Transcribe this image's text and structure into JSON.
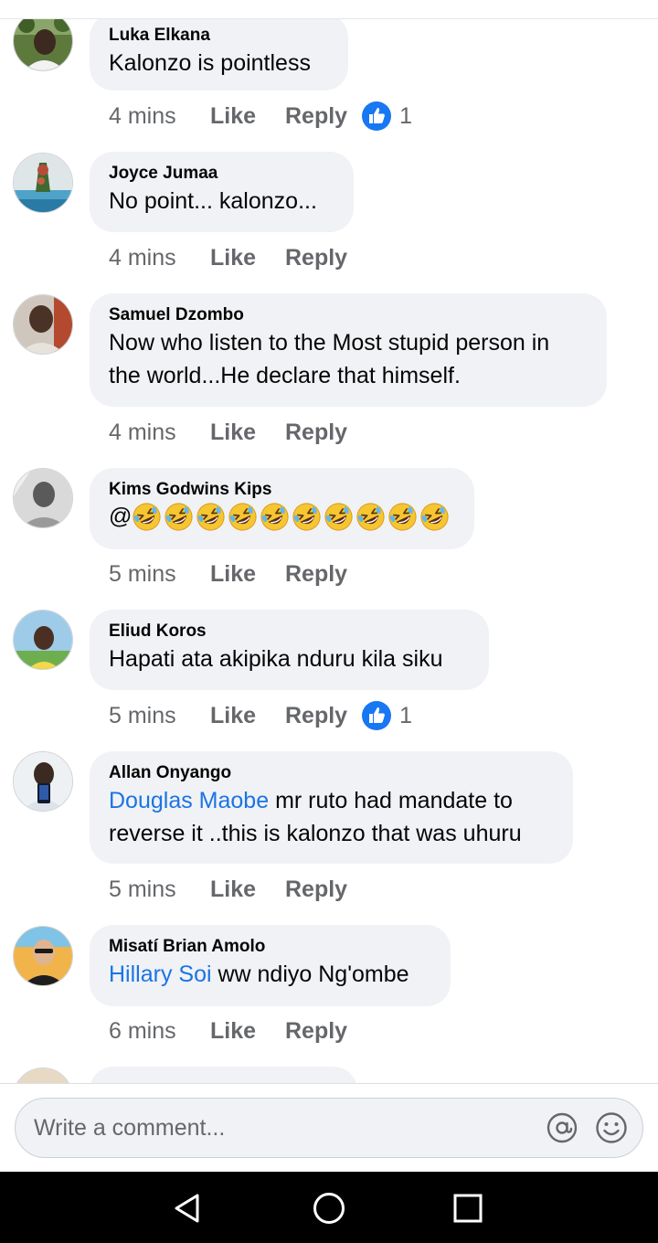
{
  "comments": [
    {
      "author": "Luka Elkana",
      "text": "Kalonzo is pointless",
      "time": "4 mins",
      "like": "Like",
      "reply": "Reply",
      "reactions": "1"
    },
    {
      "author": "Joyce Jumaa",
      "text": "No point... kalonzo...",
      "time": "4 mins",
      "like": "Like",
      "reply": "Reply"
    },
    {
      "author": "Samuel Dzombo",
      "line1": "Now who listen to the Most stupid person in",
      "line2": "the world...He declare that himself.",
      "time": "4 mins",
      "like": "Like",
      "reply": "Reply"
    },
    {
      "author": "Kims Godwins Kips",
      "text_prefix": "@",
      "emoji": "rolling-on-floor-laughing",
      "emoji_count": 10,
      "time": "5 mins",
      "like": "Like",
      "reply": "Reply"
    },
    {
      "author": "Eliud Koros",
      "text": "Hapati ata akipika nduru kila siku",
      "time": "5 mins",
      "like": "Like",
      "reply": "Reply",
      "reactions": "1"
    },
    {
      "author": "Allan Onyango",
      "mention": "Douglas Maobe",
      "line1_rest": " mr ruto had mandate to",
      "line2": "reverse it ..this is kalonzo that was uhuru",
      "time": "5 mins",
      "like": "Like",
      "reply": "Reply"
    },
    {
      "author": "Misatí Brian Amolo",
      "mention": "Hillary Soi",
      "text_rest": " ww ndiyo Ng'ombe",
      "time": "6 mins",
      "like": "Like",
      "reply": "Reply"
    }
  ],
  "composer": {
    "placeholder": "Write a comment..."
  },
  "icons": {
    "like_reaction": "thumbs-up-icon",
    "mention": "at-sign-icon",
    "emoji_picker": "smiley-icon",
    "nav_back": "back-triangle-icon",
    "nav_home": "home-circle-icon",
    "nav_recents": "recents-square-icon"
  },
  "colors": {
    "bubble": "#f0f2f5",
    "mention": "#1b74e4",
    "meta": "#65676b",
    "like_badge": "#1877f2",
    "navbar": "#000000"
  }
}
